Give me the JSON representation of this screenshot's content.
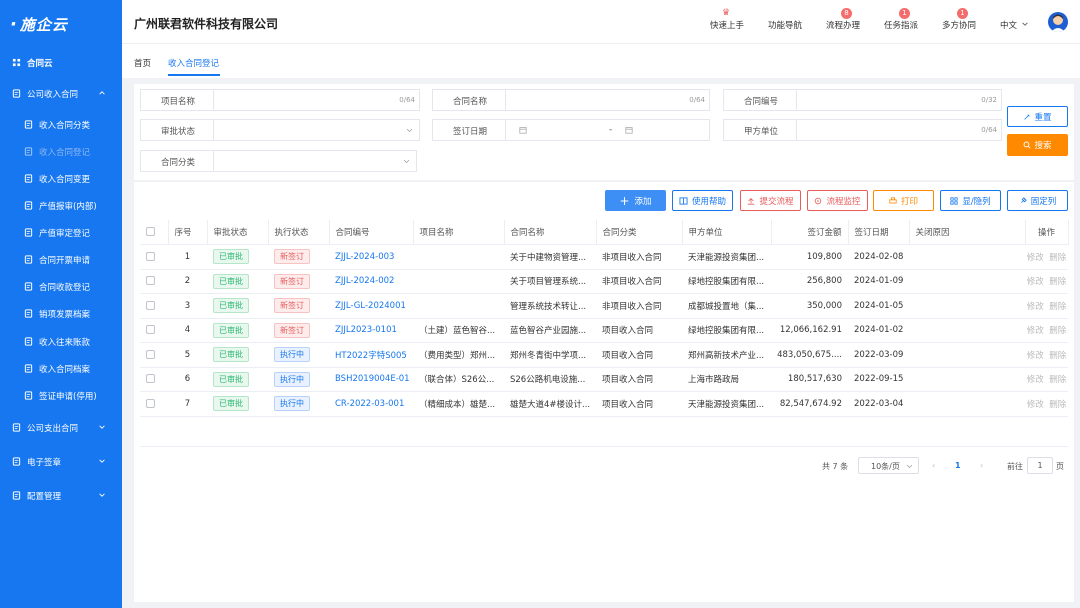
{
  "brand": {
    "logo_text": "施企云"
  },
  "sidebar": {
    "items": [
      {
        "label": "合同云",
        "icon": "grid-icon",
        "level": 0,
        "bold": true
      },
      {
        "label": "公司收入合同",
        "icon": "doc-icon",
        "level": 0,
        "expanded": true
      },
      {
        "label": "收入合同分类",
        "icon": "category-icon",
        "level": 1
      },
      {
        "label": "收入合同登记",
        "icon": "register-icon",
        "level": 1,
        "active": true
      },
      {
        "label": "收入合同变更",
        "icon": "change-icon",
        "level": 1
      },
      {
        "label": "产值报审(内部)",
        "icon": "edit-icon",
        "level": 1
      },
      {
        "label": "产值审定登记",
        "icon": "audit-icon",
        "level": 1
      },
      {
        "label": "合同开票申请",
        "icon": "invoice-icon",
        "level": 1
      },
      {
        "label": "合同收款登记",
        "icon": "payment-icon",
        "level": 1
      },
      {
        "label": "销项发票档案",
        "icon": "archive-icon",
        "level": 1
      },
      {
        "label": "收入往来账款",
        "icon": "account-icon",
        "level": 1
      },
      {
        "label": "收入合同档案",
        "icon": "file-icon",
        "level": 1
      },
      {
        "label": "签证申请(停用)",
        "icon": "visa-icon",
        "level": 1
      },
      {
        "label": "公司支出合同",
        "icon": "doc-icon",
        "level": 0,
        "collapsed": true
      },
      {
        "label": "电子签章",
        "icon": "seal-icon",
        "level": 0,
        "collapsed": true
      },
      {
        "label": "配置管理",
        "icon": "config-icon",
        "level": 0,
        "collapsed": true
      }
    ]
  },
  "header": {
    "company": "广州联君软件科技有限公司",
    "nav": [
      {
        "label": "快速上手",
        "badge": "new"
      },
      {
        "label": "功能导航",
        "badge": ""
      },
      {
        "label": "流程办理",
        "badge": "8"
      },
      {
        "label": "任务指派",
        "badge": "1"
      },
      {
        "label": "多方协同",
        "badge": "1"
      }
    ],
    "language": "中文"
  },
  "tabs": [
    {
      "label": "首页",
      "active": false
    },
    {
      "label": "收入合同登记",
      "active": true
    }
  ],
  "filters": {
    "project_name": {
      "label": "项目名称",
      "count": "0/64"
    },
    "contract_name": {
      "label": "合同名称",
      "count": "0/64"
    },
    "contract_no": {
      "label": "合同编号",
      "count": "0/32"
    },
    "approval_status": {
      "label": "审批状态"
    },
    "sign_date": {
      "label": "签订日期",
      "sep": "-"
    },
    "party_a": {
      "label": "甲方单位",
      "count": "0/64"
    },
    "contract_category": {
      "label": "合同分类"
    },
    "reset_label": "重置",
    "search_label": "搜索"
  },
  "toolbar": {
    "add": "添加",
    "help": "使用帮助",
    "submit_flow": "提交流程",
    "flow_monitor": "流程监控",
    "print": "打印",
    "show_hide": "显/隐列",
    "fix_cols": "固定列"
  },
  "table": {
    "columns": [
      "序号",
      "审批状态",
      "执行状态",
      "合同编号",
      "项目名称",
      "合同名称",
      "合同分类",
      "甲方单位",
      "签订金额",
      "签订日期",
      "关闭原因",
      "操作"
    ],
    "rows": [
      {
        "no": "1",
        "approval": "已审批",
        "exec": "新签订",
        "exec_type": "red",
        "code": "ZJJL-2024-003",
        "project": "",
        "name": "关于中建物资管理...",
        "category": "非项目收入合同",
        "party": "天津能源投资集团...",
        "amount": "109,800",
        "date": "2024-02-08",
        "reason": "",
        "edit": "修改",
        "del": "删除"
      },
      {
        "no": "2",
        "approval": "已审批",
        "exec": "新签订",
        "exec_type": "red",
        "code": "ZJJL-2024-002",
        "project": "",
        "name": "关于项目管理系统...",
        "category": "非项目收入合同",
        "party": "绿地控股集团有限...",
        "amount": "256,800",
        "date": "2024-01-09",
        "reason": "",
        "edit": "修改",
        "del": "删除"
      },
      {
        "no": "3",
        "approval": "已审批",
        "exec": "新签订",
        "exec_type": "red",
        "code": "ZJJL-GL-2024001",
        "project": "",
        "name": "管理系统技术转让...",
        "category": "非项目收入合同",
        "party": "成都城投置地（集...",
        "amount": "350,000",
        "date": "2024-01-05",
        "reason": "",
        "edit": "修改",
        "del": "删除"
      },
      {
        "no": "4",
        "approval": "已审批",
        "exec": "新签订",
        "exec_type": "red",
        "code": "ZJJL2023-0101",
        "project": "（土建）蓝色智谷...",
        "name": "蓝色智谷产业园施...",
        "category": "项目收入合同",
        "party": "绿地控股集团有限...",
        "amount": "12,066,162.91",
        "date": "2024-01-02",
        "reason": "",
        "edit": "修改",
        "del": "删除"
      },
      {
        "no": "5",
        "approval": "已审批",
        "exec": "执行中",
        "exec_type": "blue",
        "code": "HT2022字特S005",
        "project": "（费用类型）郑州...",
        "name": "郑州冬青街中学项...",
        "category": "项目收入合同",
        "party": "郑州高新技术产业...",
        "amount": "483,050,675....",
        "date": "2022-03-09",
        "reason": "",
        "edit": "修改",
        "del": "删除"
      },
      {
        "no": "6",
        "approval": "已审批",
        "exec": "执行中",
        "exec_type": "blue",
        "code": "BSH2019004E-01",
        "project": "（联合体）S26公...",
        "name": "S26公路机电设施...",
        "category": "项目收入合同",
        "party": "上海市路政局",
        "amount": "180,517,630",
        "date": "2022-09-15",
        "reason": "",
        "edit": "修改",
        "del": "删除"
      },
      {
        "no": "7",
        "approval": "已审批",
        "exec": "执行中",
        "exec_type": "blue",
        "code": "CR-2022-03-001",
        "project": "（精细成本）雄楚...",
        "name": "雄楚大道4#楼设计...",
        "category": "项目收入合同",
        "party": "天津能源投资集团...",
        "amount": "82,547,674.92",
        "date": "2022-03-04",
        "reason": "",
        "edit": "修改",
        "del": "删除"
      }
    ]
  },
  "pagination": {
    "total": "共 7 条",
    "page_size": "10条/页",
    "current_page": "1",
    "goto_label": "前往",
    "goto_value": "1",
    "page_suffix": "页"
  },
  "colors": {
    "primary": "#1677f0",
    "orange": "#ff8a00",
    "red": "#e85c5c",
    "green": "#2eb872"
  }
}
